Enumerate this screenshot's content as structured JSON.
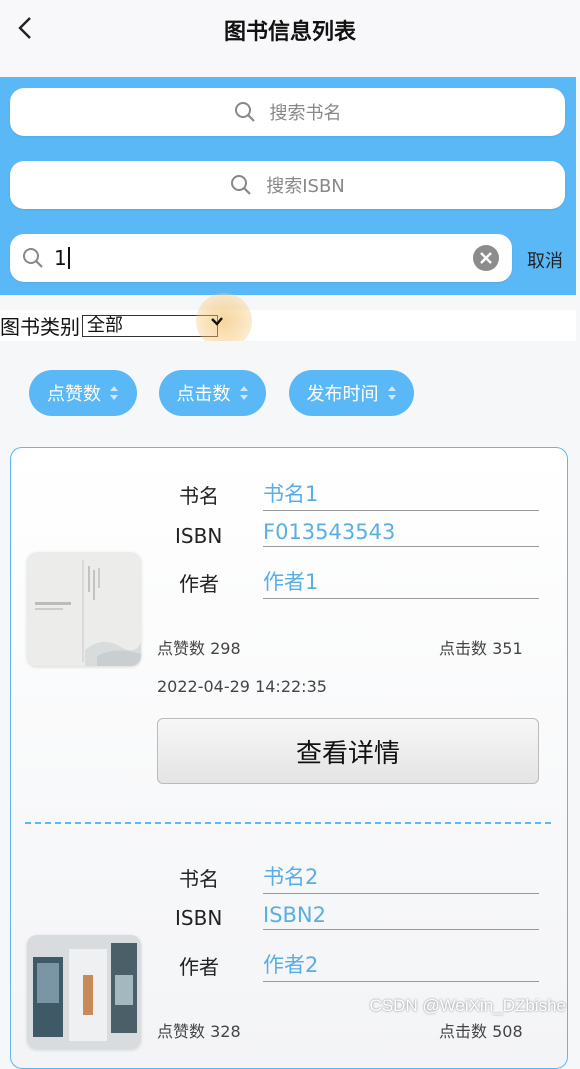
{
  "header": {
    "title": "图书信息列表"
  },
  "search": {
    "name_placeholder": "搜索书名",
    "isbn_placeholder": "搜索ISBN",
    "active_value": "1",
    "cancel_label": "取消"
  },
  "filter": {
    "category_label": "图书类别",
    "category_value": "全部"
  },
  "sort": {
    "buttons": [
      "点赞数",
      "点击数",
      "发布时间"
    ]
  },
  "books": [
    {
      "name_label": "书名",
      "name": "书名1",
      "isbn_label": "ISBN",
      "isbn": "F013543543",
      "author_label": "作者",
      "author": "作者1",
      "likes": "点赞数 298",
      "clicks": "点击数 351",
      "time": "2022-04-29 14:22:35",
      "detail_label": "查看详情"
    },
    {
      "name_label": "书名",
      "name": "书名2",
      "isbn_label": "ISBN",
      "isbn": "ISBN2",
      "author_label": "作者",
      "author": "作者2",
      "likes": "点赞数 328",
      "clicks": "点击数 508"
    }
  ],
  "watermark": "CSDN @WeiXin_DZbishe",
  "colors": {
    "accent": "#5bb8f6",
    "value_text": "#5aaee6"
  }
}
